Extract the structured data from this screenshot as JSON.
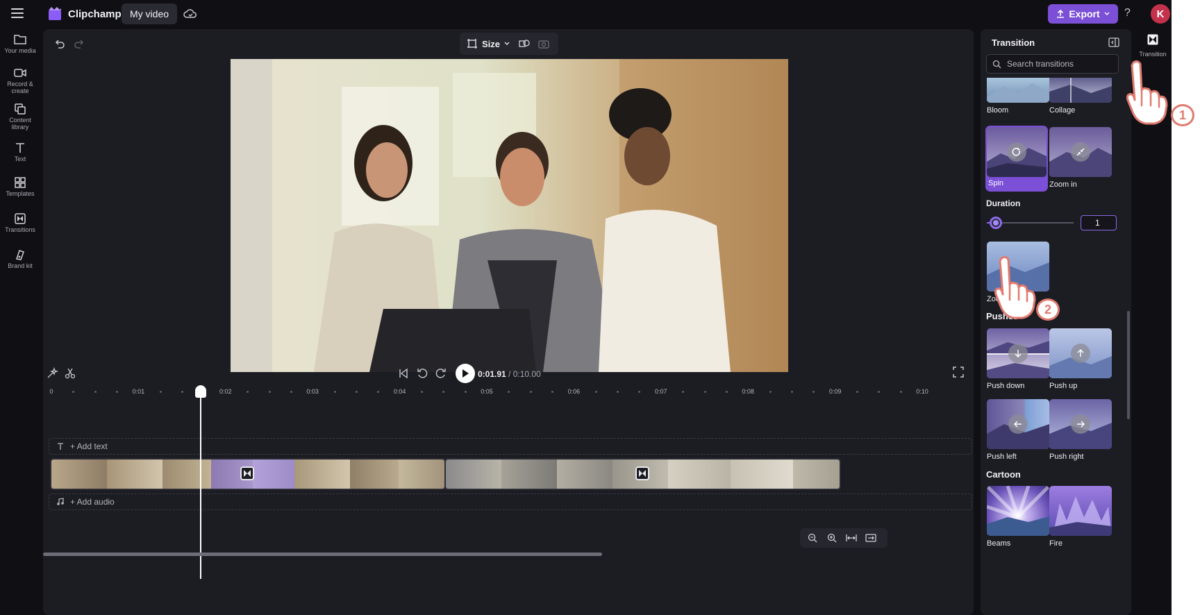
{
  "app": {
    "name": "Clipchamp",
    "project_title": "My video",
    "export_label": "Export",
    "help": "?",
    "avatar_initial": "K"
  },
  "rail": [
    {
      "label": "Your media",
      "icon": "folder-icon"
    },
    {
      "label": "Record & create",
      "icon": "camera-icon"
    },
    {
      "label": "Content library",
      "icon": "library-icon"
    },
    {
      "label": "Text",
      "icon": "text-icon"
    },
    {
      "label": "Templates",
      "icon": "templates-icon"
    },
    {
      "label": "Transitions",
      "icon": "transitions-icon"
    },
    {
      "label": "Brand kit",
      "icon": "brand-kit-icon"
    }
  ],
  "preview": {
    "size_label": "Size"
  },
  "playback": {
    "current": "0:01.91",
    "total": "/ 0:10.00"
  },
  "timeline": {
    "ticks": [
      "0",
      "0:01",
      "0:02",
      "0:03",
      "0:04",
      "0:05",
      "0:06",
      "0:07",
      "0:08",
      "0:09",
      "0:10"
    ],
    "add_text": "+ Add text",
    "add_audio": "+ Add audio"
  },
  "panel": {
    "title": "Transition",
    "search_placeholder": "Search transitions",
    "duration_label": "Duration",
    "duration_value": "1",
    "duration_level": 0.1,
    "sections": {
      "pushes": "Pushes",
      "cartoon": "Cartoon"
    },
    "cards": [
      {
        "label": "Bloom"
      },
      {
        "label": "Collage"
      },
      {
        "label": "Spin",
        "selected": true
      },
      {
        "label": "Zoom in"
      },
      {
        "label": "Zoom out"
      },
      {
        "label": "Push down"
      },
      {
        "label": "Push up"
      },
      {
        "label": "Push left"
      },
      {
        "label": "Push right"
      },
      {
        "label": "Beams"
      },
      {
        "label": "Fire"
      }
    ]
  },
  "tab": {
    "label": "Transition"
  },
  "steps": [
    "1",
    "2"
  ],
  "colors": {
    "accent": "#7b4fd6",
    "background": "#101014",
    "surface": "#1c1c23"
  }
}
